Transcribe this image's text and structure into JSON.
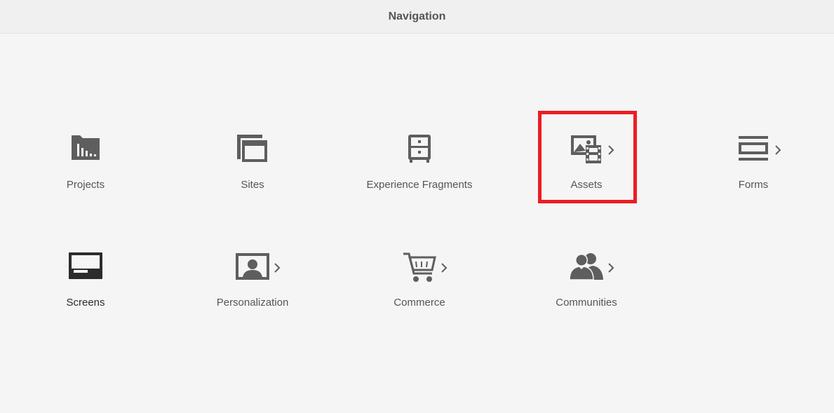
{
  "header": {
    "title": "Navigation"
  },
  "tiles": [
    {
      "label": "Projects",
      "icon": "projects-icon",
      "has_children": false
    },
    {
      "label": "Sites",
      "icon": "sites-icon",
      "has_children": false
    },
    {
      "label": "Experience Fragments",
      "icon": "experience-fragments-icon",
      "has_children": false
    },
    {
      "label": "Assets",
      "icon": "assets-icon",
      "has_children": true,
      "highlighted": true
    },
    {
      "label": "Forms",
      "icon": "forms-icon",
      "has_children": true
    },
    {
      "label": "Screens",
      "icon": "screens-icon",
      "has_children": false
    },
    {
      "label": "Personalization",
      "icon": "personalization-icon",
      "has_children": true
    },
    {
      "label": "Commerce",
      "icon": "commerce-icon",
      "has_children": true
    },
    {
      "label": "Communities",
      "icon": "communities-icon",
      "has_children": true
    }
  ],
  "colors": {
    "background": "#f5f5f5",
    "header_background": "#f0f0f0",
    "icon": "#5e5e5e",
    "highlight": "#ec1c24"
  }
}
